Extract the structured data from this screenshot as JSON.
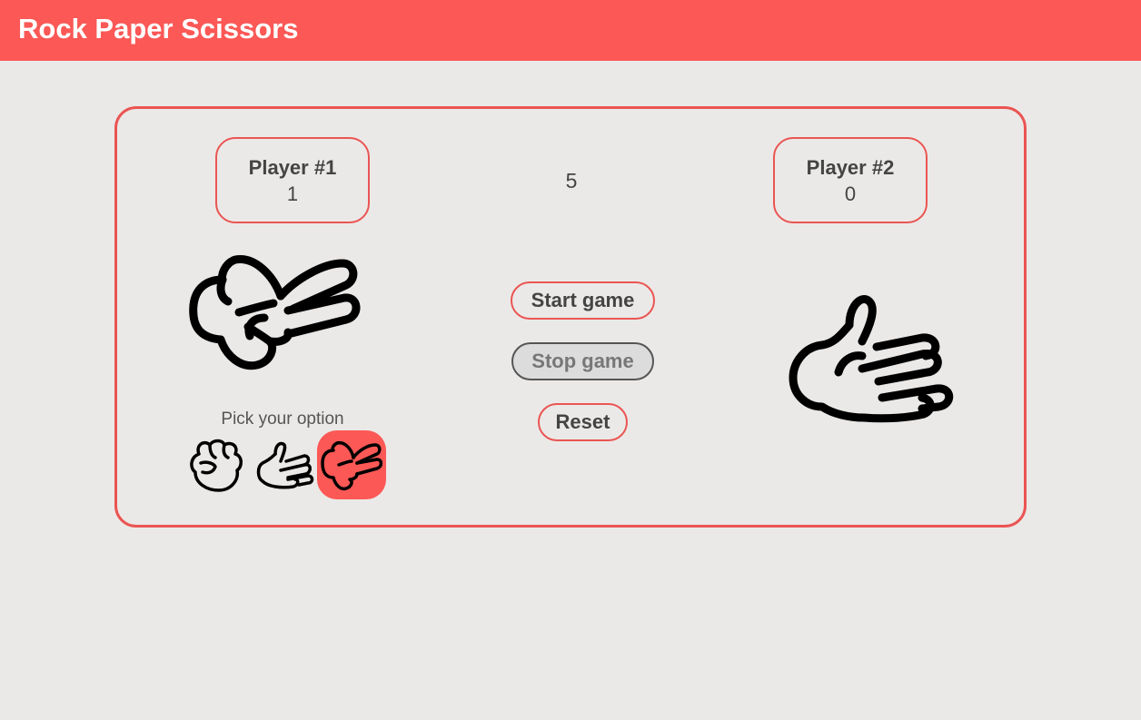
{
  "header": {
    "title": "Rock Paper Scissors"
  },
  "player1": {
    "name": "Player #1",
    "score": "1",
    "current_choice": "scissors-icon"
  },
  "player2": {
    "name": "Player #2",
    "score": "0",
    "current_choice": "paper-icon"
  },
  "round": {
    "value": "5"
  },
  "controls": {
    "start_label": "Start game",
    "stop_label": "Stop game",
    "reset_label": "Reset"
  },
  "picker": {
    "label": "Pick your option",
    "options": [
      {
        "icon": "rock-icon"
      },
      {
        "icon": "paper-icon"
      },
      {
        "icon": "scissors-icon",
        "selected": true
      }
    ]
  },
  "colors": {
    "accent": "#fb5856",
    "border": "#ea5553",
    "background": "#ebe9e7",
    "text": "#444444",
    "disabled_bg": "#dcdcdc"
  }
}
